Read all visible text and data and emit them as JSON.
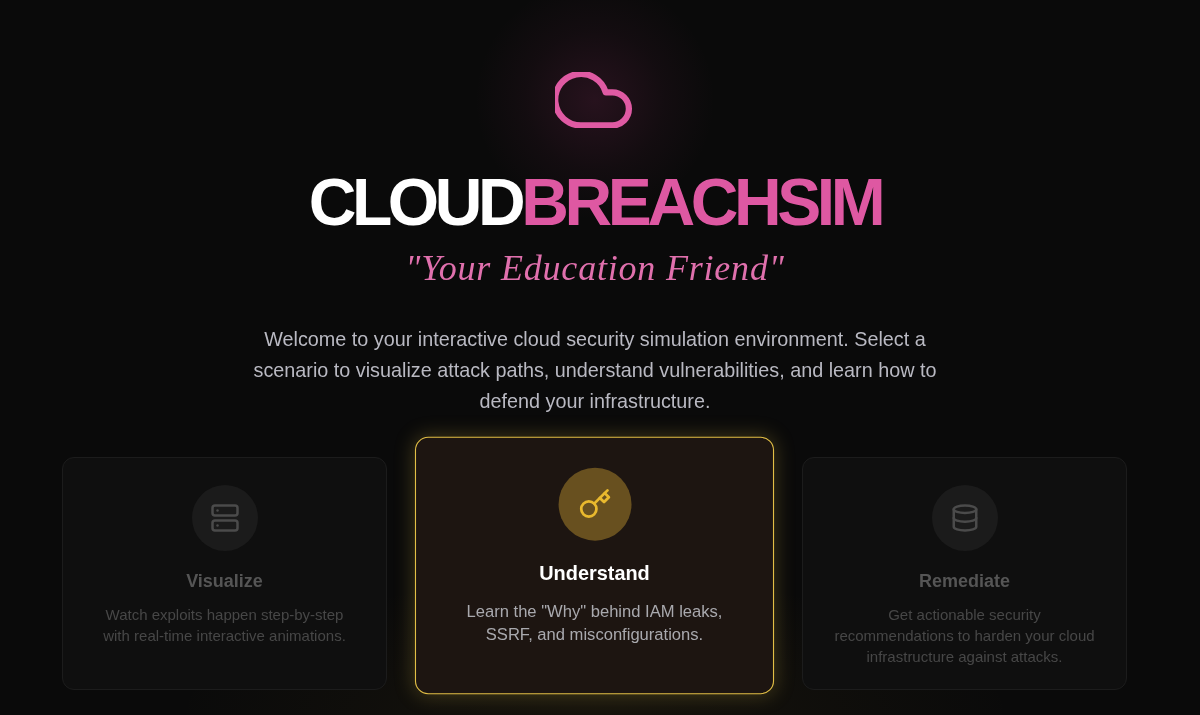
{
  "hero": {
    "title_parts": [
      {
        "text": "CLOUD",
        "accent": false
      },
      {
        "text": "BREACHSIM",
        "accent": true
      }
    ],
    "tagline": "\"Your Education Friend\"",
    "intro": "Welcome to your interactive cloud security simulation environment. Select a scenario to visualize attack paths, understand vulnerabilities, and learn how to defend your infrastructure."
  },
  "cards": [
    {
      "title": "Visualize",
      "description": "Watch exploits happen step-by-step with real-time interactive animations.",
      "selected": false
    },
    {
      "title": "Understand",
      "description": "Learn the \"Why\" behind IAM leaks, SSRF, and misconfigurations.",
      "selected": true
    },
    {
      "title": "Remediate",
      "description": "Get actionable security recommendations to harden your cloud infrastructure against attacks.",
      "selected": false
    }
  ]
}
